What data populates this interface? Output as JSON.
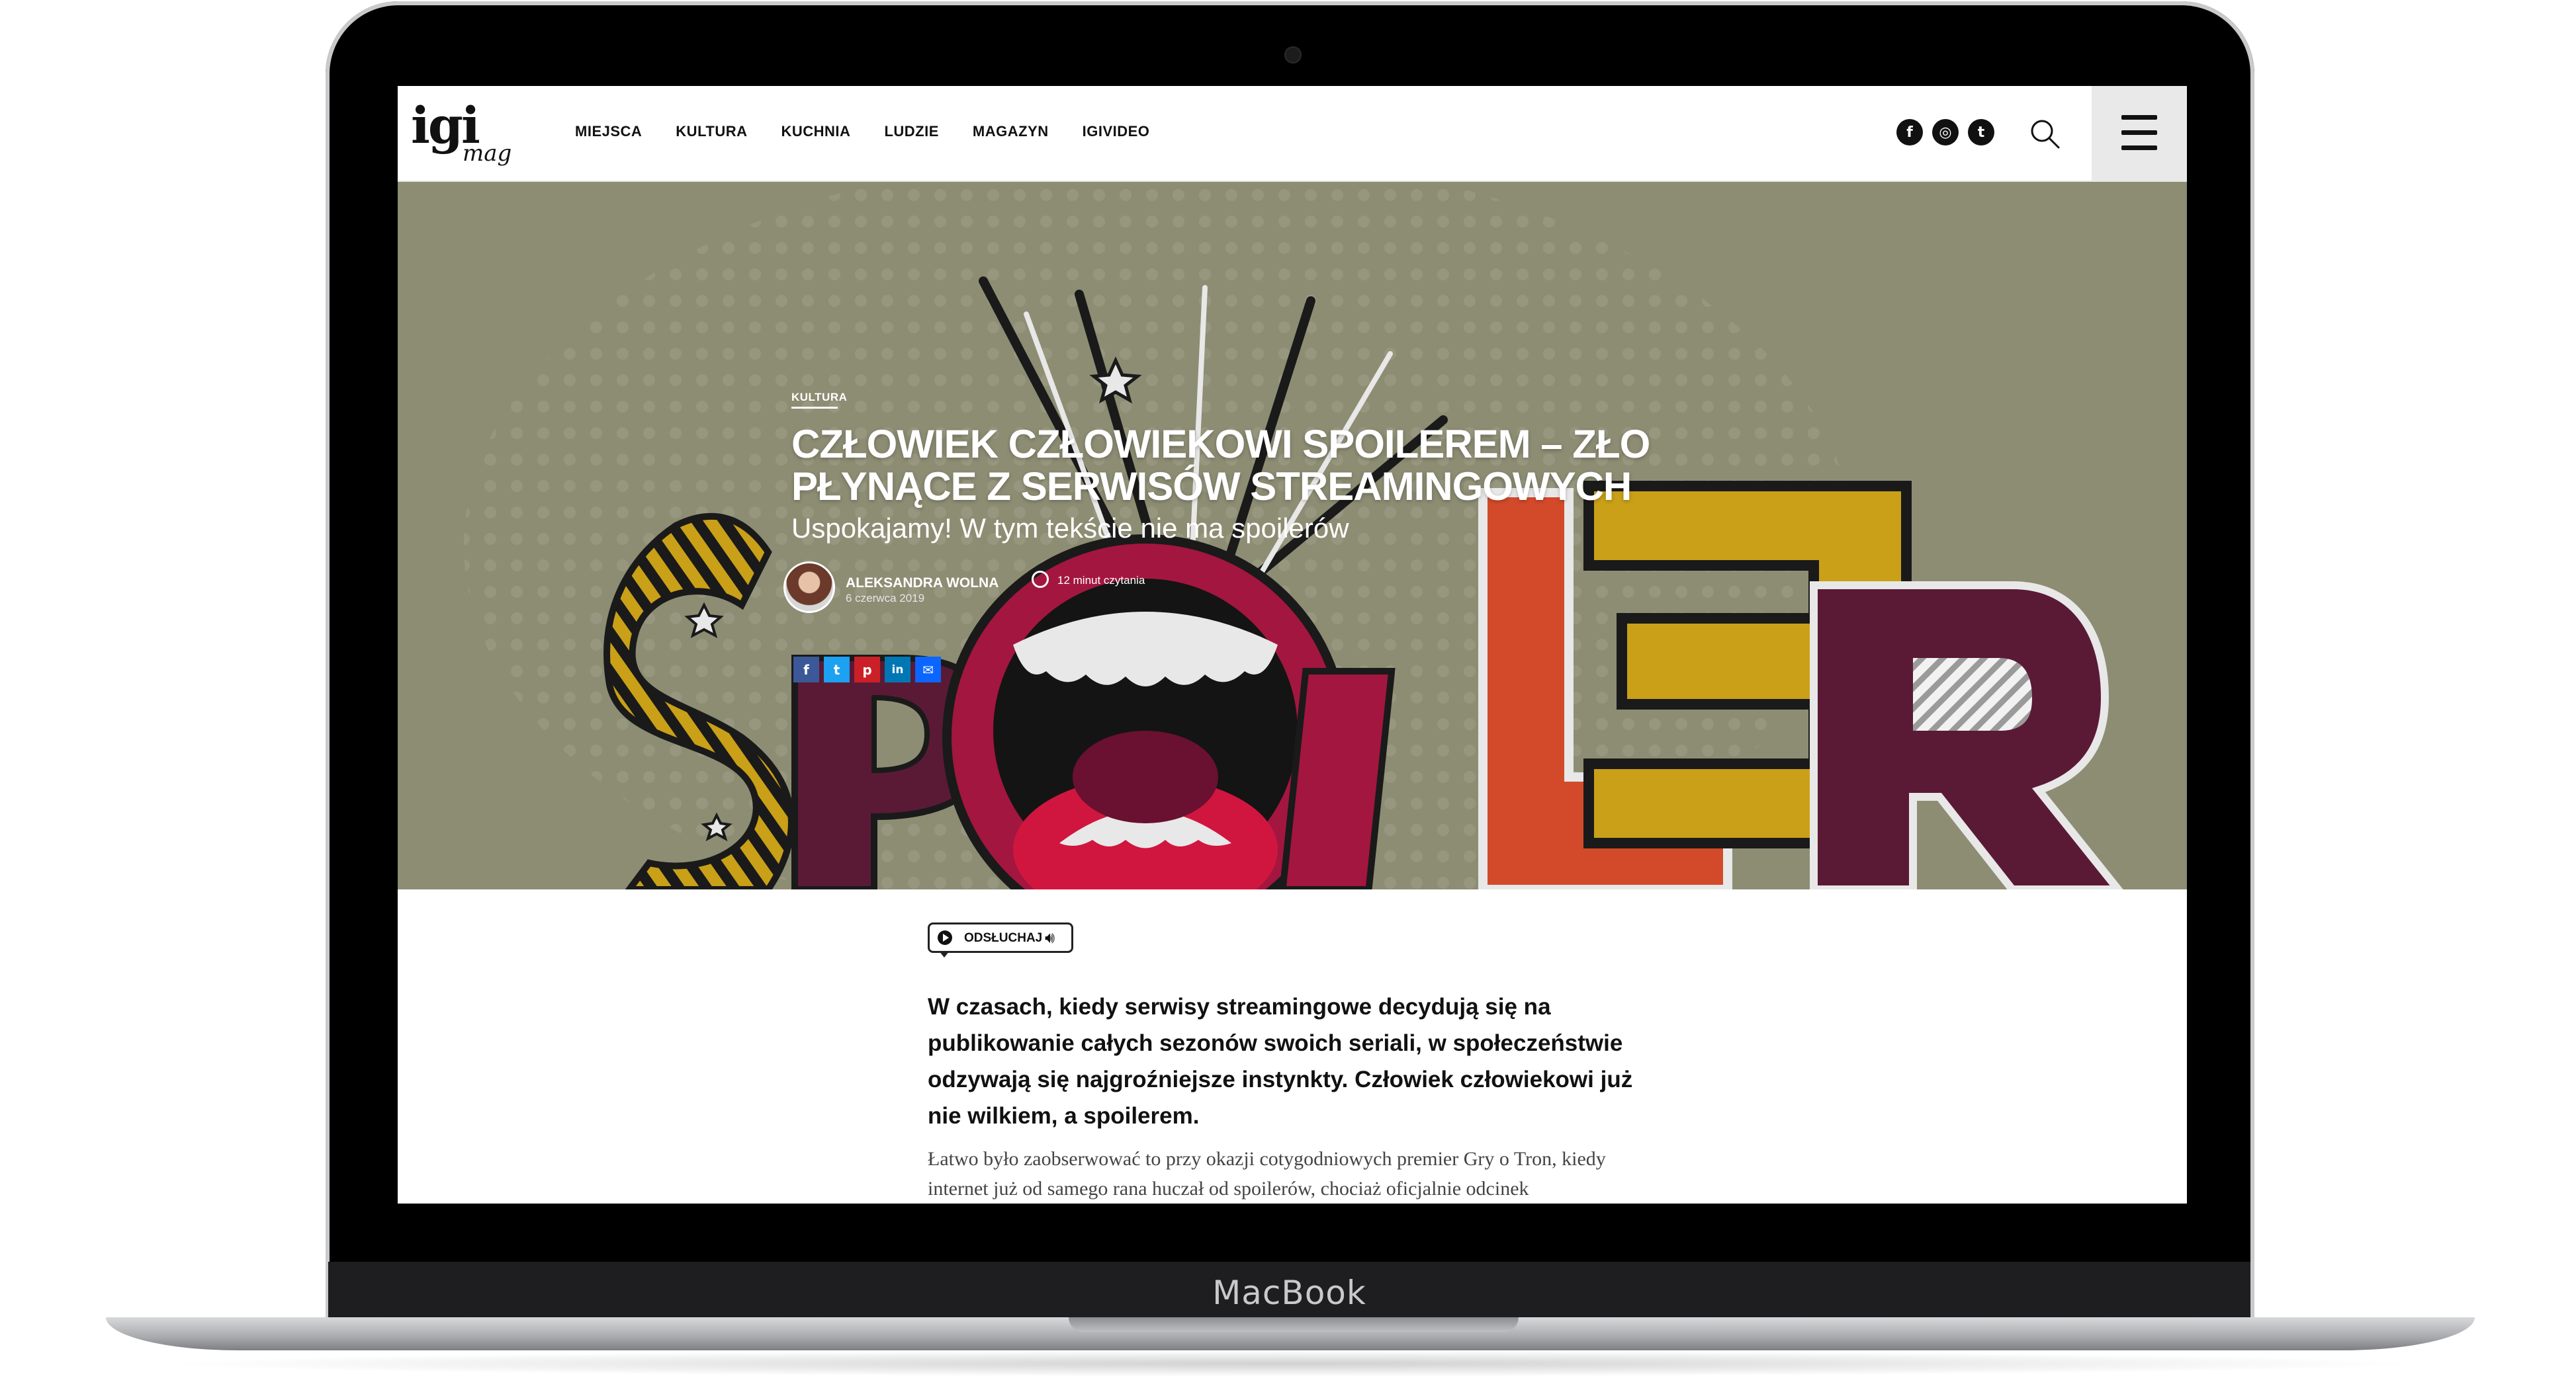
{
  "device": {
    "label": "MacBook"
  },
  "nav": {
    "logo_main": "igi",
    "logo_sub": "mag",
    "menu": [
      "MIEJSCA",
      "KULTURA",
      "KUCHNIA",
      "LUDZIE",
      "MAGAZYN",
      "IGIVIDEO"
    ],
    "social": [
      {
        "icon": "facebook-icon",
        "glyph": "f"
      },
      {
        "icon": "instagram-icon",
        "glyph": "◎"
      },
      {
        "icon": "twitter-icon",
        "glyph": "t"
      }
    ]
  },
  "hero": {
    "category": "KULTURA",
    "title": "CZŁOWIEK CZŁOWIEKOWI SPOILEREM – ZŁO PŁYNĄCE Z SERWISÓW STREAMINGOWYCH",
    "subtitle": "Uspokajamy! W tym tekście nie ma spoilerów",
    "author": "ALEKSANDRA WOLNA",
    "date": "6 czerwca 2019",
    "read_time": "12 minut czytania",
    "share": [
      {
        "icon": "facebook-share-icon",
        "glyph": "f",
        "color": "#3b5998"
      },
      {
        "icon": "twitter-share-icon",
        "glyph": "t",
        "color": "#1da1f2"
      },
      {
        "icon": "pinterest-share-icon",
        "glyph": "p",
        "color": "#cb2027"
      },
      {
        "icon": "linkedin-share-icon",
        "glyph": "in",
        "color": "#0077b5"
      },
      {
        "icon": "email-share-icon",
        "glyph": "✉",
        "color": "#0a66ff"
      }
    ],
    "background_color": "#8d8d74"
  },
  "article": {
    "listen_label": "ODSŁUCHAJ",
    "lead": "W czasach, kiedy serwisy streamingowe decydują się na publikowanie całych sezonów swoich seriali, w społeczeństwie odzywają się najgroźniejsze instynkty. Człowiek człowiekowi już nie wilkiem, a spoilerem.",
    "body": "Łatwo było zaobserwować to przy okazji cotygodniowych premier Gry o Tron, kiedy internet już od samego rana huczał od spoilerów, chociaż oficjalnie odcinek"
  }
}
